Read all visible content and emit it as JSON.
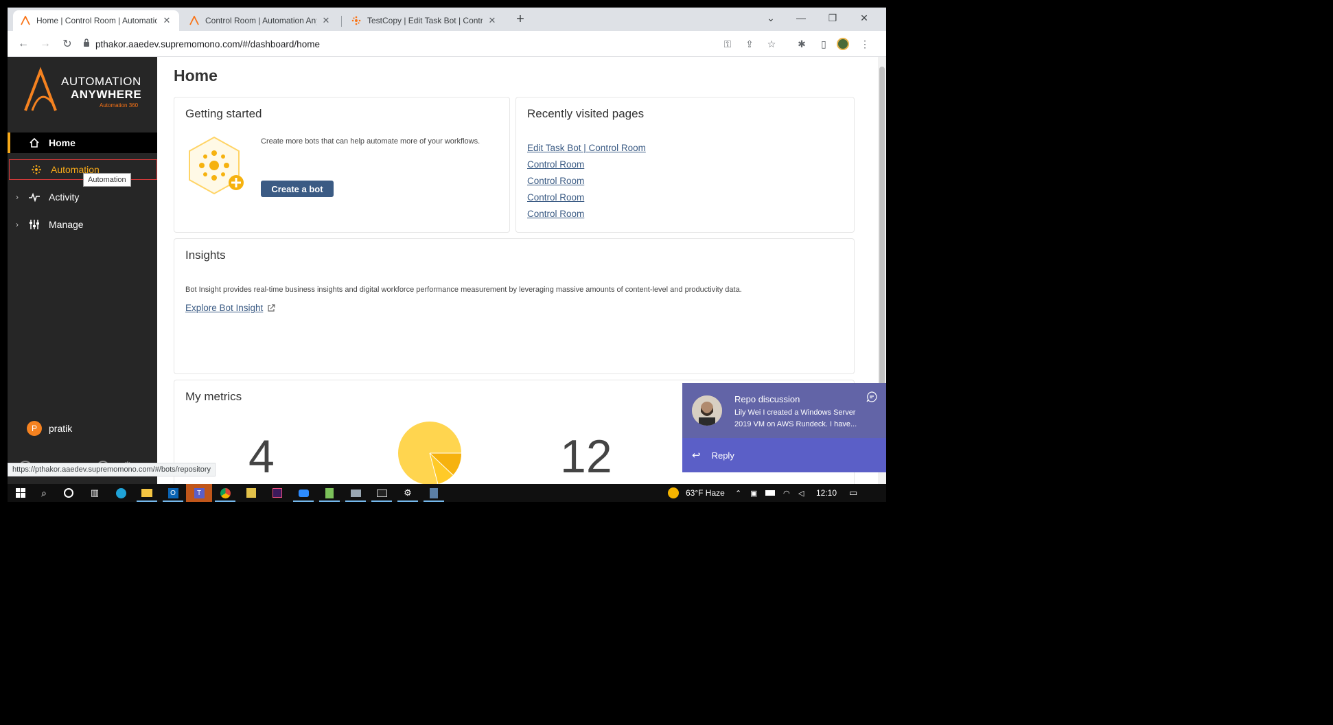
{
  "browser": {
    "tabs": [
      {
        "title": "Home | Control Room | Automation Anywhere"
      },
      {
        "title": "Control Room | Automation Anywhere"
      },
      {
        "title": "TestCopy | Edit Task Bot | Control Room"
      }
    ],
    "url": "pthakor.aaedev.supremomono.com/#/dashboard/home",
    "status_url": "https://pthakor.aaedev.supremomono.com/#/bots/repository"
  },
  "sidebar": {
    "brand_line1": "AUTOMATION",
    "brand_line2": "ANYWHERE",
    "brand_line3": "Automation 360",
    "items": [
      {
        "label": "Home",
        "icon": "home-icon"
      },
      {
        "label": "Automation",
        "icon": "automation-icon"
      },
      {
        "label": "Activity",
        "icon": "activity-icon"
      },
      {
        "label": "Manage",
        "icon": "manage-icon"
      }
    ],
    "tooltip": "Automation",
    "user_initial": "P",
    "user_name": "pratik"
  },
  "main": {
    "title": "Home",
    "getting_started": {
      "title": "Getting started",
      "text": "Create more bots that can help automate more of your workflows.",
      "button": "Create a bot"
    },
    "recent": {
      "title": "Recently visited pages",
      "links": [
        "Edit Task Bot | Control Room",
        "Control Room",
        "Control Room",
        "Control Room",
        "Control Room"
      ]
    },
    "insights": {
      "title": "Insights",
      "text": "Bot Insight provides real-time business insights and digital workforce performance measurement by leveraging massive amounts of content-level and productivity data.",
      "link": "Explore Bot Insight"
    },
    "metrics": {
      "title": "My metrics",
      "values": [
        "4",
        "12"
      ]
    }
  },
  "toast": {
    "title": "Repo discussion",
    "message": "Lily Wei I created a Windows Server 2019 VM on AWS Rundeck. I have...",
    "reply": "Reply"
  },
  "taskbar": {
    "weather": "63°F  Haze",
    "time": "12:10"
  },
  "colors": {
    "accent": "#f6a91a",
    "primary_button": "#3b5b84",
    "sidebar_bg": "#262626",
    "teams": "#6264a7"
  }
}
